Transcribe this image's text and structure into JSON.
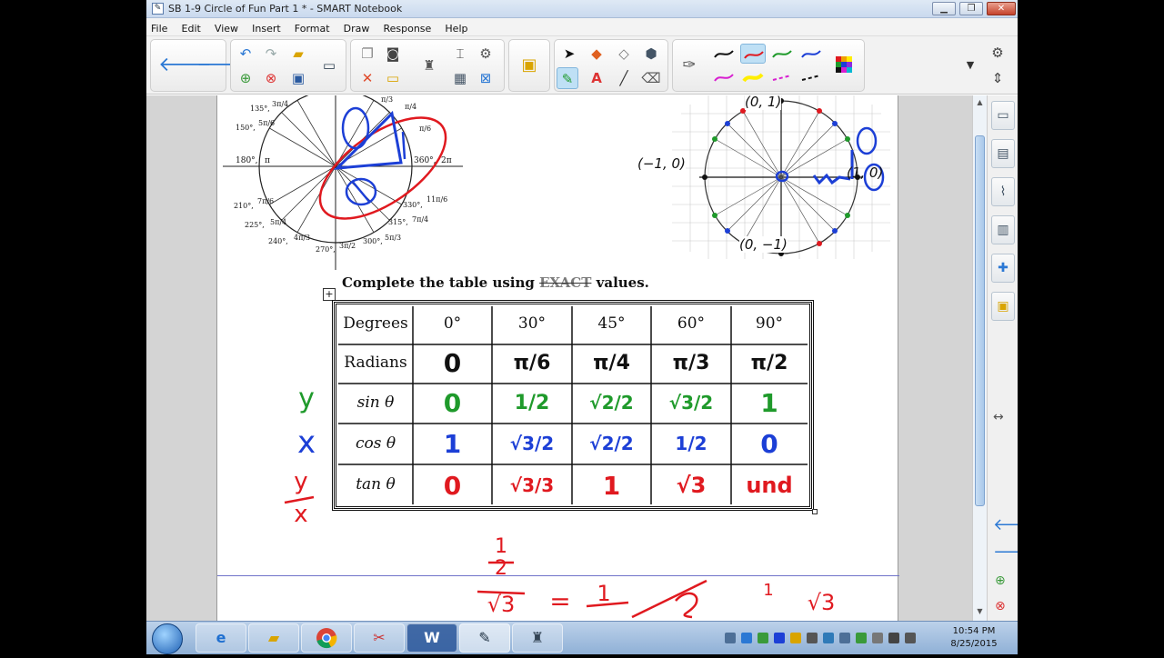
{
  "window": {
    "title": "SB 1-9 Circle of Fun Part 1 * - SMART Notebook",
    "controls": {
      "minimize": "▁",
      "maximize": "❐",
      "close": "✕"
    }
  },
  "menu": [
    "File",
    "Edit",
    "View",
    "Insert",
    "Format",
    "Draw",
    "Response",
    "Help"
  ],
  "toolbar": {
    "back_icon": "arrow-left-icon",
    "forward_icon": "arrow-right-icon",
    "color_accent": "#bfe0f5"
  },
  "left_diagram": {
    "angles": [
      "135°,",
      "150°,",
      "180°,",
      "210°,",
      "225°,",
      "240°,",
      "270°,",
      "300°,",
      "315°,",
      "330°,",
      "360°,"
    ],
    "radians": [
      "3π/4",
      "5π/6",
      "π",
      "7π/6",
      "5π/4",
      "4π/3",
      "3π/2",
      "5π/3",
      "7π/4",
      "11π/6",
      "2π",
      "π/4",
      "π/6",
      "π/3"
    ]
  },
  "right_diagram": {
    "labels": {
      "top": "(0, 1)",
      "bottom": "(0, −1)",
      "left": "(−1, 0)",
      "right": "(1, 0)"
    }
  },
  "worksheet": {
    "instruction_prefix": "Complete the table using",
    "instruction_hidden": "EXACT",
    "instruction_suffix": "values."
  },
  "table": {
    "row_headers": [
      "Degrees",
      "Radians",
      "sin θ",
      "cos θ",
      "tan θ"
    ],
    "column_headers": [
      "0°",
      "30°",
      "45°",
      "60°",
      "90°"
    ],
    "radians_handwritten": [
      "0",
      "π/6",
      "π/4",
      "π/3",
      "π/2"
    ],
    "sin_handwritten": [
      "0",
      "1/2",
      "√2/2",
      "√3/2",
      "1"
    ],
    "cos_handwritten": [
      "1",
      "√3/2",
      "√2/2",
      "1/2",
      "0"
    ],
    "tan_handwritten": [
      "0",
      "√3/3",
      "1",
      "√3",
      "und"
    ],
    "ink_colors": {
      "black": "#111111",
      "green": "#1f9a2b",
      "blue": "#1c3fd6",
      "red": "#e0191f"
    }
  },
  "margin_notes": {
    "sin": "y",
    "cos": "x",
    "tan_top": "y",
    "tan_bottom": "x"
  },
  "bottom_work": {
    "numer": "1",
    "denom_top": "2",
    "denom_bottom": "√3",
    "equals": "=",
    "rhs_top": "1",
    "right_top": "1",
    "right_bottom": "√3"
  },
  "side_tabs": [
    "page-sorter-icon",
    "gallery-icon",
    "attachments-icon",
    "properties-icon",
    "addons-icon",
    "lesson-activity-icon"
  ],
  "taskbar": {
    "apps": [
      "start-orb-icon",
      "internet-explorer-icon",
      "file-explorer-icon",
      "chrome-icon",
      "snipping-tool-icon",
      "word-icon",
      "smart-notebook-icon",
      "smart-tools-icon"
    ],
    "time": "10:54 PM",
    "date": "8/25/2015"
  }
}
